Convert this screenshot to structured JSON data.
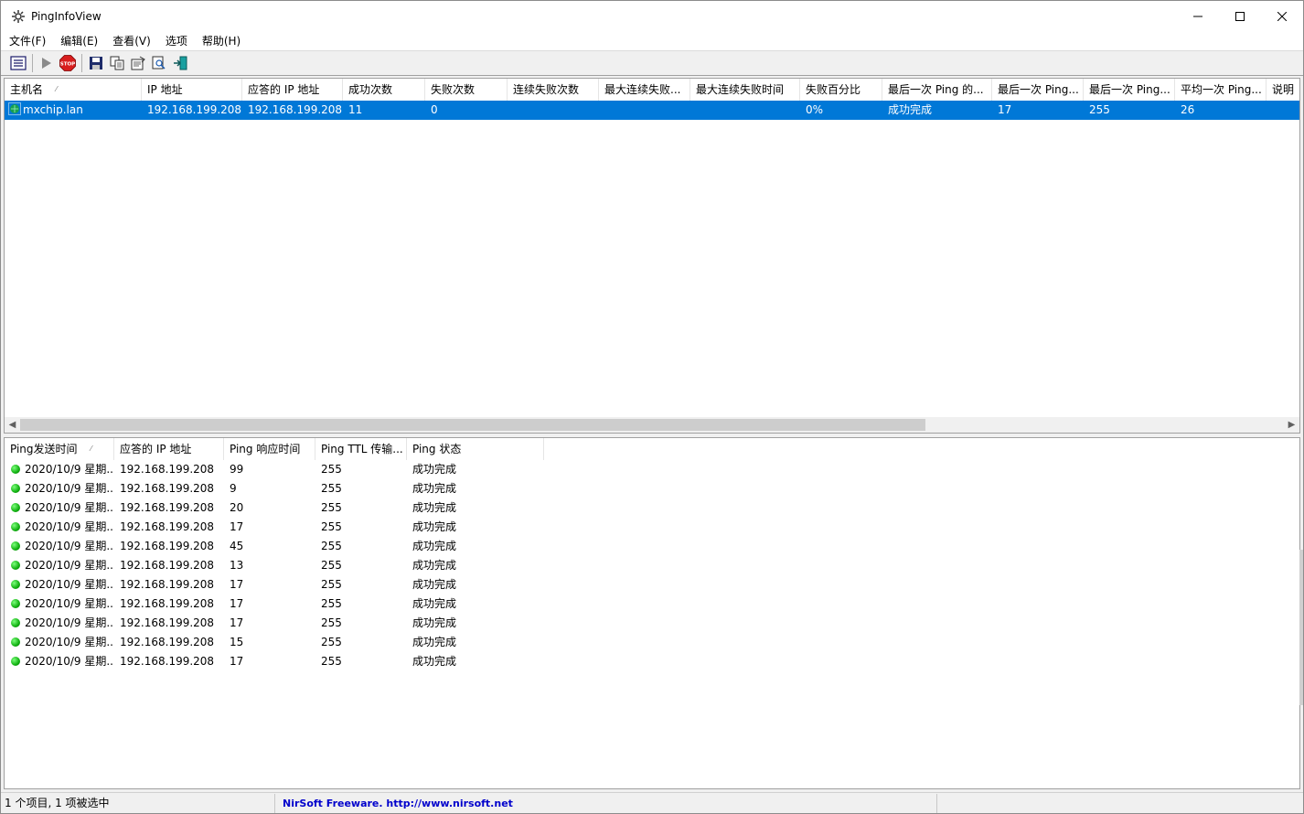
{
  "window": {
    "title": "PingInfoView",
    "controls": [
      "minimize",
      "maximize",
      "close"
    ]
  },
  "menu": {
    "items": [
      {
        "label": "文件(F)"
      },
      {
        "label": "编辑(E)"
      },
      {
        "label": "查看(V)"
      },
      {
        "label": "选项"
      },
      {
        "label": "帮助(H)"
      }
    ]
  },
  "toolbar": {
    "buttons": [
      {
        "icon": "list-icon"
      },
      {
        "icon": "play-icon"
      },
      {
        "icon": "stop-icon",
        "text": "STOP"
      },
      {
        "icon": "save-icon"
      },
      {
        "icon": "copy-icon"
      },
      {
        "icon": "properties-icon"
      },
      {
        "icon": "find-icon"
      },
      {
        "icon": "exit-icon"
      }
    ]
  },
  "hosts_table": {
    "columns": [
      {
        "label": "主机名",
        "sorted": true
      },
      {
        "label": "IP 地址"
      },
      {
        "label": "应答的 IP 地址"
      },
      {
        "label": "成功次数"
      },
      {
        "label": "失败次数"
      },
      {
        "label": "连续失败次数"
      },
      {
        "label": "最大连续失败..."
      },
      {
        "label": "最大连续失败时间"
      },
      {
        "label": "失败百分比"
      },
      {
        "label": "最后一次 Ping 的..."
      },
      {
        "label": "最后一次 Ping..."
      },
      {
        "label": "最后一次 Ping..."
      },
      {
        "label": "平均一次 Ping..."
      },
      {
        "label": "说明"
      }
    ],
    "rows": [
      {
        "selected": true,
        "cells": [
          "mxchip.lan",
          "192.168.199.208",
          "192.168.199.208",
          "11",
          "0",
          "",
          "",
          "",
          "0%",
          "成功完成",
          "17",
          "255",
          "26",
          ""
        ]
      }
    ]
  },
  "pings_table": {
    "columns": [
      {
        "label": "Ping发送时间",
        "sorted": true
      },
      {
        "label": "应答的 IP 地址"
      },
      {
        "label": "Ping 响应时间"
      },
      {
        "label": "Ping TTL 传输..."
      },
      {
        "label": "Ping 状态"
      }
    ],
    "rows": [
      {
        "time": "2020/10/9 星期...",
        "ip": "192.168.199.208",
        "response": "99",
        "ttl": "255",
        "status": "成功完成"
      },
      {
        "time": "2020/10/9 星期...",
        "ip": "192.168.199.208",
        "response": "9",
        "ttl": "255",
        "status": "成功完成"
      },
      {
        "time": "2020/10/9 星期...",
        "ip": "192.168.199.208",
        "response": "20",
        "ttl": "255",
        "status": "成功完成"
      },
      {
        "time": "2020/10/9 星期...",
        "ip": "192.168.199.208",
        "response": "17",
        "ttl": "255",
        "status": "成功完成"
      },
      {
        "time": "2020/10/9 星期...",
        "ip": "192.168.199.208",
        "response": "45",
        "ttl": "255",
        "status": "成功完成"
      },
      {
        "time": "2020/10/9 星期...",
        "ip": "192.168.199.208",
        "response": "13",
        "ttl": "255",
        "status": "成功完成"
      },
      {
        "time": "2020/10/9 星期...",
        "ip": "192.168.199.208",
        "response": "17",
        "ttl": "255",
        "status": "成功完成"
      },
      {
        "time": "2020/10/9 星期...",
        "ip": "192.168.199.208",
        "response": "17",
        "ttl": "255",
        "status": "成功完成"
      },
      {
        "time": "2020/10/9 星期...",
        "ip": "192.168.199.208",
        "response": "17",
        "ttl": "255",
        "status": "成功完成"
      },
      {
        "time": "2020/10/9 星期...",
        "ip": "192.168.199.208",
        "response": "15",
        "ttl": "255",
        "status": "成功完成"
      },
      {
        "time": "2020/10/9 星期...",
        "ip": "192.168.199.208",
        "response": "17",
        "ttl": "255",
        "status": "成功完成"
      }
    ]
  },
  "statusbar": {
    "items_text": "1 个项目, 1 项被选中",
    "link_text": "NirSoft Freeware.  http://www.nirsoft.net"
  },
  "colors": {
    "selection": "#0078d7",
    "link": "#0000cc",
    "ok_dot": "#10b010"
  }
}
